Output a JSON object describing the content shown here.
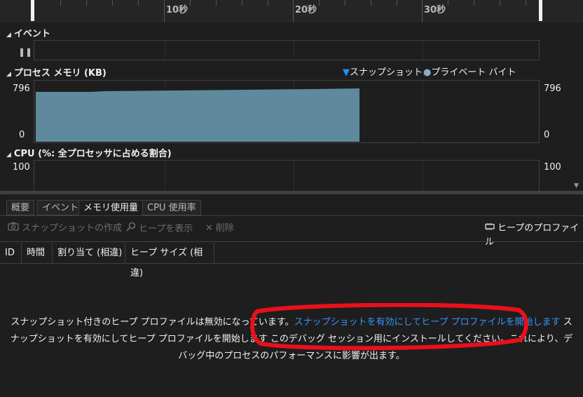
{
  "timeline": {
    "ticks": [
      "10秒",
      "20秒",
      "30秒"
    ]
  },
  "events": {
    "title": "イベント",
    "pause_icon": "pause-icon"
  },
  "memory": {
    "title": "プロセス メモリ (KB)",
    "legend_snapshot": "スナップショット",
    "legend_private": "プライベート バイト",
    "y_max": "796",
    "y_min": "0",
    "fill_color": "#5f8a9e",
    "snapshot_color": "#1e90ff",
    "private_color": "#87aec7"
  },
  "cpu": {
    "title": "CPU (%: 全プロセッサに占める割合)",
    "y_max": "100"
  },
  "tabs": [
    {
      "label": "概要"
    },
    {
      "label": "イベント"
    },
    {
      "label": "メモリ使用量"
    },
    {
      "label": "CPU 使用率"
    }
  ],
  "toolbar": {
    "take_snapshot": "スナップショットの作成",
    "view_heap": "ヒープを表示",
    "delete": "削除",
    "heap_profile": "ヒープのプロファイル"
  },
  "table": {
    "columns": [
      "ID",
      "時間",
      "割り当て (相違)",
      "ヒープ サイズ (相違)"
    ]
  },
  "message": {
    "text_before": "スナップショット付きのヒープ プロファイルは無効になっています。",
    "link": "スナップショットを有効にしてヒープ プロファイルを開始します",
    "text_after": " スナップショットを有効にしてヒープ プロファイルを開始します このデバッグ セッション用にインストールしてください。これにより、デバッグ中のプロセスのパフォーマンスに影響が出ます。"
  }
}
